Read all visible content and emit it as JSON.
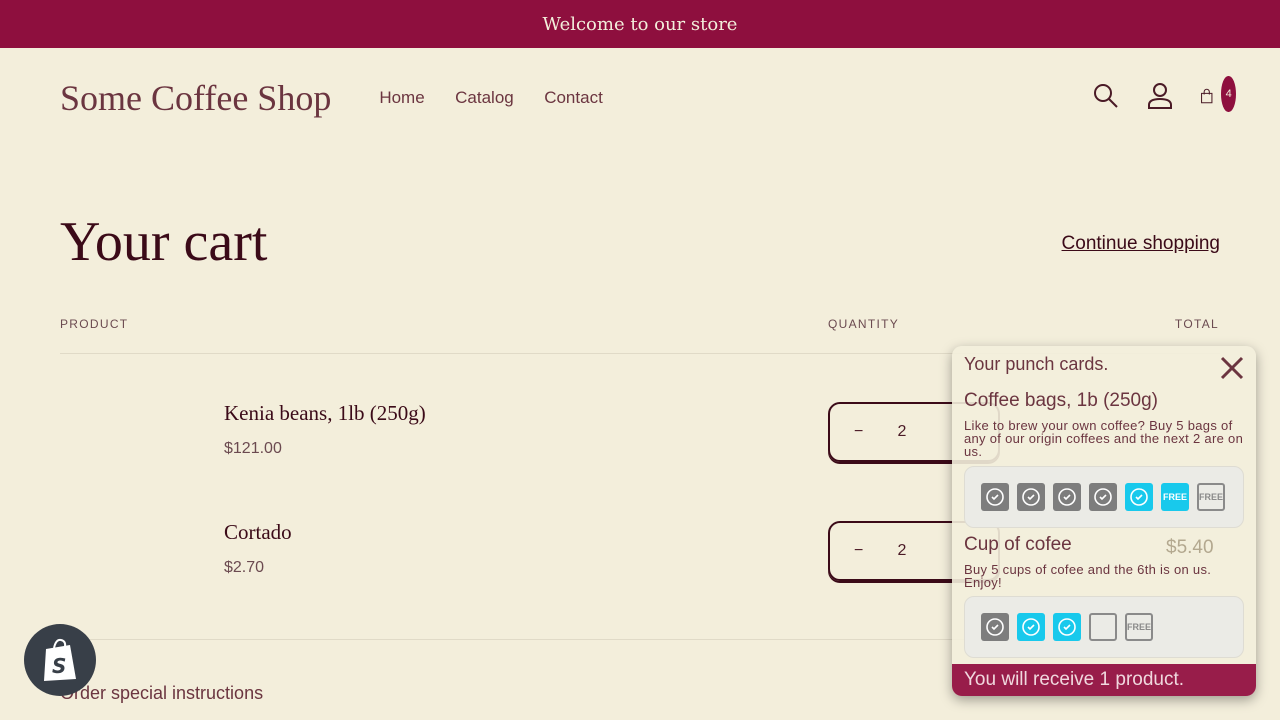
{
  "banner": {
    "text": "Welcome to our store"
  },
  "header": {
    "logo": "Some Coffee Shop",
    "nav": [
      "Home",
      "Catalog",
      "Contact"
    ],
    "cart_count": "4",
    "icons": [
      "search-icon",
      "account-icon",
      "cart-icon"
    ]
  },
  "cart": {
    "title": "Your cart",
    "continue": "Continue shopping",
    "columns": {
      "product": "PRODUCT",
      "quantity": "QUANTITY",
      "total": "TOTAL"
    },
    "items": [
      {
        "name": "Kenia beans, 1lb (250g)",
        "price": "$121.00",
        "qty": "2",
        "total": ""
      },
      {
        "name": "Cortado",
        "price": "$2.70",
        "qty": "2",
        "total": "$5.40"
      }
    ],
    "instructions_label": "Order special instructions"
  },
  "popup": {
    "title": "Your punch cards.",
    "cards": [
      {
        "name": "Coffee bags, 1b (250g)",
        "desc": "Like to brew your own coffee? Buy 5 bags of any of our origin coffees and the next 2 are on us.",
        "stamps": [
          "filled",
          "filled",
          "filled",
          "filled",
          "new",
          "free-earned",
          "free"
        ]
      },
      {
        "name": "Cup of cofee",
        "desc": "Buy 5 cups of cofee and the 6th is on us. Enjoy!",
        "stamps": [
          "filled",
          "new",
          "new",
          "empty",
          "free"
        ]
      }
    ],
    "free_label": "FREE",
    "footer": "You will receive 1 product."
  },
  "colors": {
    "accent": "#8e0f3e",
    "background": "#f3eedb",
    "stamp_new": "#18c9ec",
    "stamp_filled": "#7d7d7d"
  }
}
